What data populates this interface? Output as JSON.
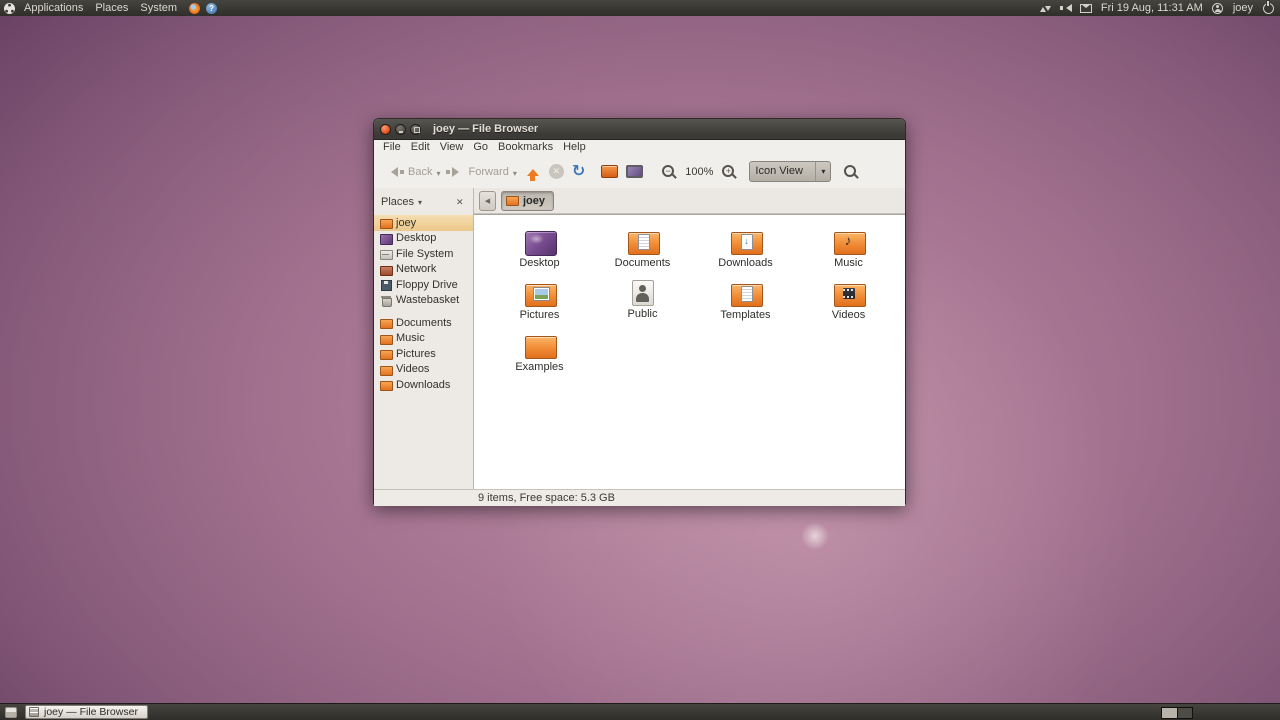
{
  "colors": {
    "panel_bg": "#3c3b37",
    "folder_orange": "#f08a33",
    "desktop_purple": "#7b4f93",
    "selection_tan": "#f0d3a0",
    "wallpaper_purple": "#6b4365"
  },
  "top_panel": {
    "menus": [
      {
        "label": "Applications"
      },
      {
        "label": "Places"
      },
      {
        "label": "System"
      }
    ],
    "icons": [
      "ubuntu-logo",
      "firefox",
      "help",
      "network-arrows",
      "volume",
      "mail",
      "user",
      "power"
    ],
    "clock": "Fri 19 Aug, 11:31 AM",
    "user": "joey"
  },
  "window": {
    "title": "joey — File Browser",
    "menubar": [
      {
        "label": "File"
      },
      {
        "label": "Edit"
      },
      {
        "label": "View"
      },
      {
        "label": "Go"
      },
      {
        "label": "Bookmarks"
      },
      {
        "label": "Help"
      }
    ],
    "toolbar": {
      "back": "Back",
      "forward": "Forward",
      "zoom_level": "100%",
      "view_mode": "Icon View"
    },
    "location": {
      "breadcrumb": "joey"
    },
    "sidebar": {
      "header": "Places",
      "items": [
        {
          "label": "joey",
          "icon": "s-folder",
          "selected": true
        },
        {
          "label": "Desktop",
          "icon": "s-desktop"
        },
        {
          "label": "File System",
          "icon": "s-drive"
        },
        {
          "label": "Network",
          "icon": "s-network"
        },
        {
          "label": "Floppy Drive",
          "icon": "s-floppy"
        },
        {
          "label": "Wastebasket",
          "icon": "s-trash"
        },
        {
          "label": "Documents",
          "icon": "s-folder"
        },
        {
          "label": "Music",
          "icon": "s-folder"
        },
        {
          "label": "Pictures",
          "icon": "s-folder"
        },
        {
          "label": "Videos",
          "icon": "s-folder"
        },
        {
          "label": "Downloads",
          "icon": "s-folder"
        }
      ]
    },
    "files": [
      {
        "name": "Desktop",
        "icon": "desktop"
      },
      {
        "name": "Documents",
        "icon": "folder-doc"
      },
      {
        "name": "Downloads",
        "icon": "folder-down"
      },
      {
        "name": "Music",
        "icon": "folder-note"
      },
      {
        "name": "Pictures",
        "icon": "folder-photo"
      },
      {
        "name": "Public",
        "icon": "person"
      },
      {
        "name": "Templates",
        "icon": "folder-doc"
      },
      {
        "name": "Videos",
        "icon": "folder-film"
      },
      {
        "name": "Examples",
        "icon": "folder"
      }
    ],
    "statusbar": "9 items, Free space: 5.3 GB"
  },
  "taskbar": {
    "window_button": "joey — File Browser"
  }
}
